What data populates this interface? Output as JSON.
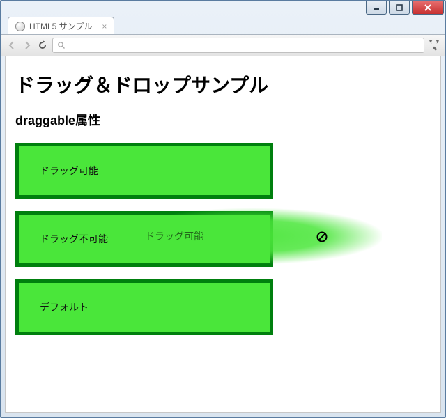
{
  "window": {
    "tab_title": "HTML5 サンプル"
  },
  "toolbar": {
    "omnibox_placeholder": ""
  },
  "page": {
    "heading": "ドラッグ＆ドロップサンプル",
    "subheading": "draggable属性",
    "boxes": [
      {
        "label": "ドラッグ可能"
      },
      {
        "label": "ドラッグ不可能"
      },
      {
        "label": "デフォルト"
      }
    ],
    "ghost_label": "ドラッグ可能"
  }
}
